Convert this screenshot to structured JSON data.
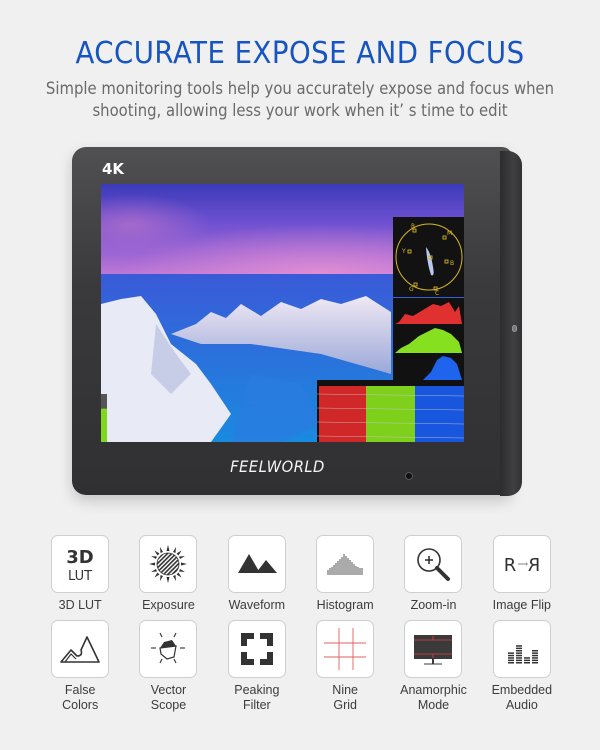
{
  "header": {
    "title": "ACCURATE EXPOSE AND FOCUS",
    "subtitle_line1": "Simple monitoring tools help you accurately expose and focus when",
    "subtitle_line2": "shooting, allowing less your work when it’ s time to edit"
  },
  "monitor": {
    "badge": "4K",
    "brand": "FEELWORLD",
    "vectorscope_labels": [
      "R",
      "M",
      "Y",
      "B",
      "G",
      "C"
    ],
    "colors": {
      "bezel": "#3c3c3e",
      "scope_line": "#d7b71f",
      "red": "#e03030",
      "green": "#86e020",
      "blue": "#1f64ec"
    }
  },
  "features": [
    {
      "icon": "3d-lut-icon",
      "glyph": "3D LUT",
      "label": "3D LUT"
    },
    {
      "icon": "exposure-icon",
      "label": "Exposure"
    },
    {
      "icon": "waveform-icon",
      "label": "Waveform"
    },
    {
      "icon": "histogram-icon",
      "label": "Histogram"
    },
    {
      "icon": "zoom-in-icon",
      "label": "Zoom-in"
    },
    {
      "icon": "image-flip-icon",
      "glyph": "R→R",
      "label": "Image Flip"
    },
    {
      "icon": "false-colors-icon",
      "label": "False\nColors"
    },
    {
      "icon": "vector-scope-icon",
      "label": "Vector\nScope"
    },
    {
      "icon": "peaking-filter-icon",
      "label": "Peaking\nFilter"
    },
    {
      "icon": "nine-grid-icon",
      "label": "Nine\nGrid"
    },
    {
      "icon": "anamorphic-mode-icon",
      "label": "Anamorphic\nMode"
    },
    {
      "icon": "embedded-audio-icon",
      "label": "Embedded\nAudio"
    }
  ],
  "colors": {
    "title": "#1554c2",
    "subtitle": "#6a6a6a",
    "background": "#f0f0f0",
    "grid_red": "#e06060"
  }
}
